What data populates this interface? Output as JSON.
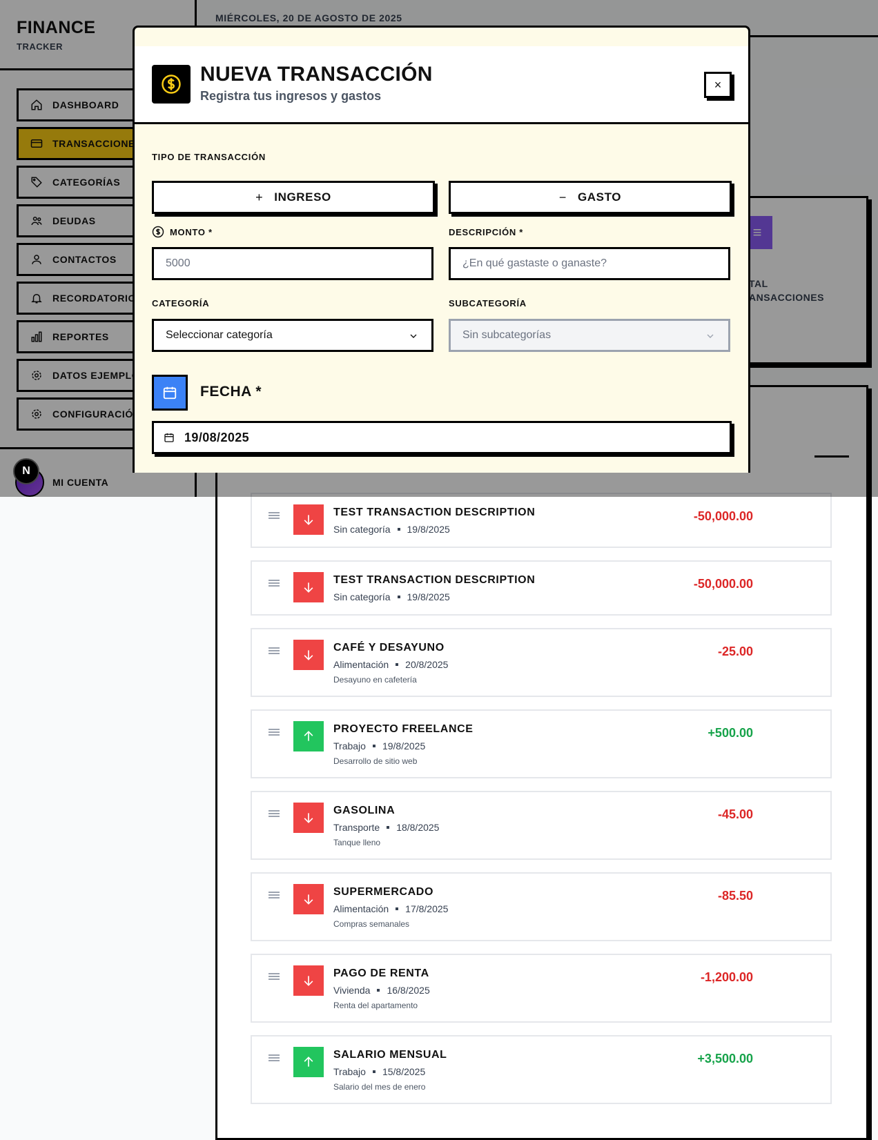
{
  "app": {
    "title": "FINANCE",
    "subtitle": "TRACKER"
  },
  "sidebar": {
    "items": [
      {
        "label": "DASHBOARD",
        "icon": "home-icon"
      },
      {
        "label": "TRANSACCIONES",
        "icon": "credit-card-icon",
        "active": true
      },
      {
        "label": "CATEGORÍAS",
        "icon": "tag-icon"
      },
      {
        "label": "DEUDAS",
        "icon": "users-icon"
      },
      {
        "label": "CONTACTOS",
        "icon": "user-icon"
      },
      {
        "label": "RECORDATORIOS",
        "icon": "bell-icon"
      },
      {
        "label": "REPORTES",
        "icon": "bar-chart-icon"
      },
      {
        "label": "DATOS EJEMPLO",
        "icon": "gear-icon"
      },
      {
        "label": "CONFIGURACIÓN",
        "icon": "gear-icon"
      }
    ],
    "account_label": "MI CUENTA",
    "next_badge": "N"
  },
  "header": {
    "date": "MIÉRCOLES, 20 DE AGOSTO DE 2025"
  },
  "stats": {
    "label_line1": "TAL",
    "label_line2": "ANSACCIONES",
    "icon": "list-icon",
    "accent": "#8b5cf6"
  },
  "transactions": [
    {
      "title": "TEST TRANSACTION DESCRIPTION",
      "category": "Sin categoría",
      "date": "19/8/2025",
      "note": "",
      "amount": "-50,000.00",
      "type": "expense"
    },
    {
      "title": "TEST TRANSACTION DESCRIPTION",
      "category": "Sin categoría",
      "date": "19/8/2025",
      "note": "",
      "amount": "-50,000.00",
      "type": "expense"
    },
    {
      "title": "CAFÉ Y DESAYUNO",
      "category": "Alimentación",
      "date": "20/8/2025",
      "note": "Desayuno en cafetería",
      "amount": "-25.00",
      "type": "expense"
    },
    {
      "title": "PROYECTO FREELANCE",
      "category": "Trabajo",
      "date": "19/8/2025",
      "note": "Desarrollo de sitio web",
      "amount": "+500.00",
      "type": "income"
    },
    {
      "title": "GASOLINA",
      "category": "Transporte",
      "date": "18/8/2025",
      "note": "Tanque lleno",
      "amount": "-45.00",
      "type": "expense"
    },
    {
      "title": "SUPERMERCADO",
      "category": "Alimentación",
      "date": "17/8/2025",
      "note": "Compras semanales",
      "amount": "-85.50",
      "type": "expense"
    },
    {
      "title": "PAGO DE RENTA",
      "category": "Vivienda",
      "date": "16/8/2025",
      "note": "Renta del apartamento",
      "amount": "-1,200.00",
      "type": "expense"
    },
    {
      "title": "SALARIO MENSUAL",
      "category": "Trabajo",
      "date": "15/8/2025",
      "note": "Salario del mes de enero",
      "amount": "+3,500.00",
      "type": "income"
    }
  ],
  "modal": {
    "title": "NUEVA TRANSACCIÓN",
    "subtitle": "Registra tus ingresos y gastos",
    "close_label": "×",
    "type_label": "TIPO DE TRANSACCIÓN",
    "income_label": "INGRESO",
    "income_symbol": "+",
    "expense_label": "GASTO",
    "expense_symbol": "−",
    "amount_label": "MONTO *",
    "amount_placeholder": "5000",
    "description_label": "DESCRIPCIÓN *",
    "description_placeholder": "¿En qué gastaste o ganaste?",
    "category_label": "CATEGORÍA",
    "category_value": "Seleccionar categoría",
    "subcategory_label": "SUBCATEGORÍA",
    "subcategory_value": "Sin subcategorías",
    "date_label": "FECHA *",
    "date_value": "19/08/2025"
  },
  "colors": {
    "accent": "#facc15",
    "expense": "#dc2626",
    "income": "#16a34a",
    "calendar": "#3b82f6",
    "modal_bg": "#fefbe8"
  }
}
